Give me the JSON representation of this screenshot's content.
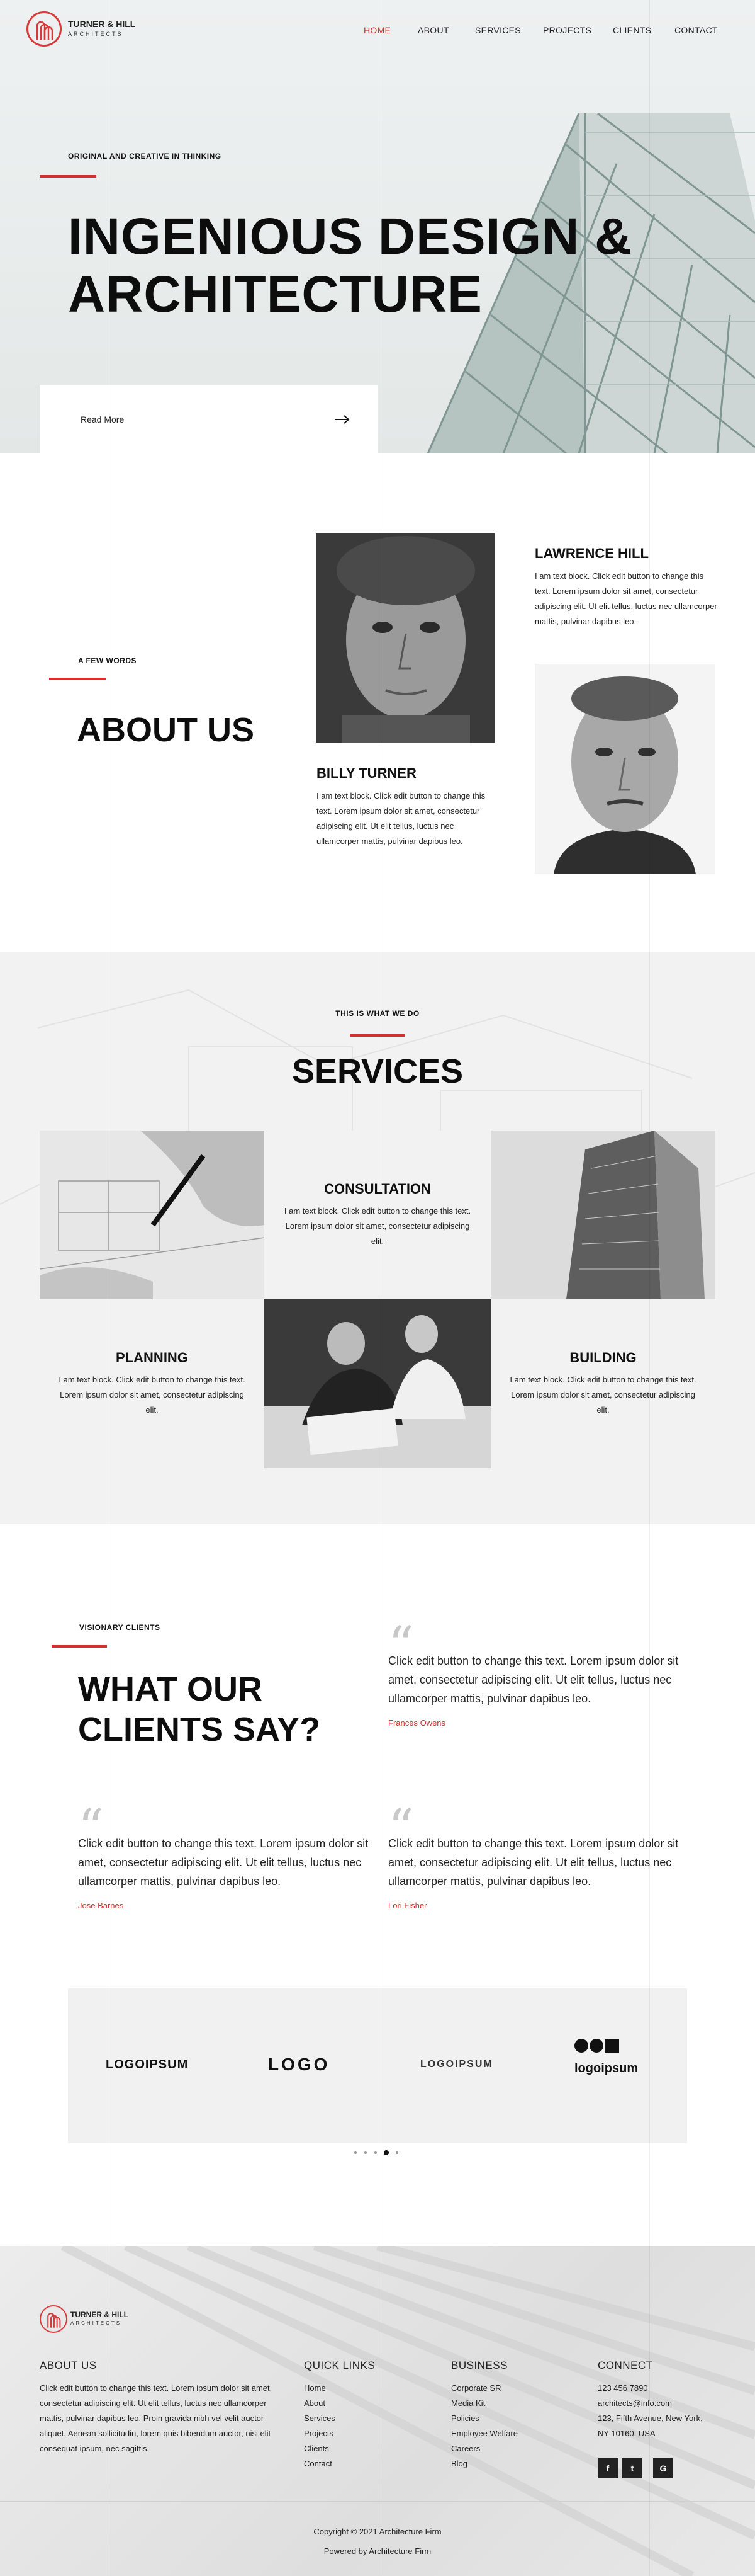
{
  "brand": {
    "name": "TURNER & HILL",
    "tagline": "ARCHITECTS"
  },
  "nav": [
    "HOME",
    "ABOUT",
    "SERVICES",
    "PROJECTS",
    "CLIENTS",
    "CONTACT"
  ],
  "hero": {
    "eyebrow": "ORIGINAL AND CREATIVE IN THINKING",
    "title_line1": "INGENIOUS DESIGN &",
    "title_line2": "ARCHITECTURE",
    "cta": "Read More"
  },
  "about": {
    "eyebrow": "A FEW WORDS",
    "title": "ABOUT US",
    "people": [
      {
        "name": "LAWRENCE HILL",
        "bio": "I am text block. Click edit button to change this text. Lorem ipsum dolor sit amet, consectetur adipiscing elit. Ut elit tellus, luctus nec ullamcorper mattis, pulvinar dapibus leo."
      },
      {
        "name": "BILLY TURNER",
        "bio": "I am text block. Click edit button to change this text. Lorem ipsum dolor sit amet, consectetur adipiscing elit. Ut elit tellus, luctus nec ullamcorper mattis, pulvinar dapibus leo."
      }
    ]
  },
  "services": {
    "eyebrow": "THIS IS WHAT WE DO",
    "title": "SERVICES",
    "items": [
      {
        "name": "CONSULTATION",
        "text": "I am text block. Click edit button to change this text. Lorem ipsum dolor sit amet, consectetur adipiscing elit."
      },
      {
        "name": "PLANNING",
        "text": "I am text block. Click edit button to change this text. Lorem ipsum dolor sit amet, consectetur adipiscing elit."
      },
      {
        "name": "BUILDING",
        "text": "I am text block. Click edit button to change this text. Lorem ipsum dolor sit amet, consectetur adipiscing elit."
      }
    ]
  },
  "clients": {
    "eyebrow": "VISIONARY CLIENTS",
    "title_line1": "WHAT OUR",
    "title_line2": "CLIENTS SAY?",
    "testimonials": [
      {
        "text": "Click edit button to change this text. Lorem ipsum dolor sit amet, consectetur adipiscing elit. Ut elit tellus, luctus nec ullamcorper mattis, pulvinar dapibus leo.",
        "name": "Frances Owens"
      },
      {
        "text": "Click edit button to change this text. Lorem ipsum dolor sit amet, consectetur adipiscing elit. Ut elit tellus, luctus nec ullamcorper mattis, pulvinar dapibus leo.",
        "name": "Jose Barnes"
      },
      {
        "text": "Click edit button to change this text. Lorem ipsum dolor sit amet, consectetur adipiscing elit. Ut elit tellus, luctus nec ullamcorper mattis, pulvinar dapibus leo.",
        "name": "Lori Fisher"
      }
    ]
  },
  "logos": [
    "LOGOIPSUM",
    "LOGO",
    "LOGOIPSUM",
    "logoipsum"
  ],
  "carousel": {
    "dots": 5,
    "active": 4
  },
  "footer": {
    "about_heading": "ABOUT US",
    "about_text": "Click edit button to change this text. Lorem ipsum dolor sit amet, consectetur adipiscing elit. Ut elit tellus, luctus nec ullamcorper mattis, pulvinar dapibus leo. Proin gravida nibh vel velit auctor aliquet. Aenean sollicitudin, lorem quis bibendum auctor, nisi elit consequat ipsum, nec sagittis.",
    "quick_heading": "QUICK LINKS",
    "quick_links": [
      "Home",
      "About",
      "Services",
      "Projects",
      "Clients",
      "Contact"
    ],
    "business_heading": "BUSINESS",
    "business_links": [
      "Corporate SR",
      "Media Kit",
      "Policies",
      "Employee Welfare",
      "Careers",
      "Blog"
    ],
    "connect_heading": "CONNECT",
    "phone": "123 456 7890",
    "email": "architects@info.com",
    "address_line1": "123, Fifth Avenue, New York,",
    "address_line2": "NY 10160, USA",
    "social": [
      "facebook-icon",
      "twitter-icon",
      "google-icon"
    ],
    "copyright": "Copyright © 2021 Architecture Firm",
    "powered": "Powered by Architecture Firm"
  },
  "colors": {
    "accent": "#d62f2f",
    "dark": "#111111",
    "muted_bg": "#f2f2f2"
  }
}
